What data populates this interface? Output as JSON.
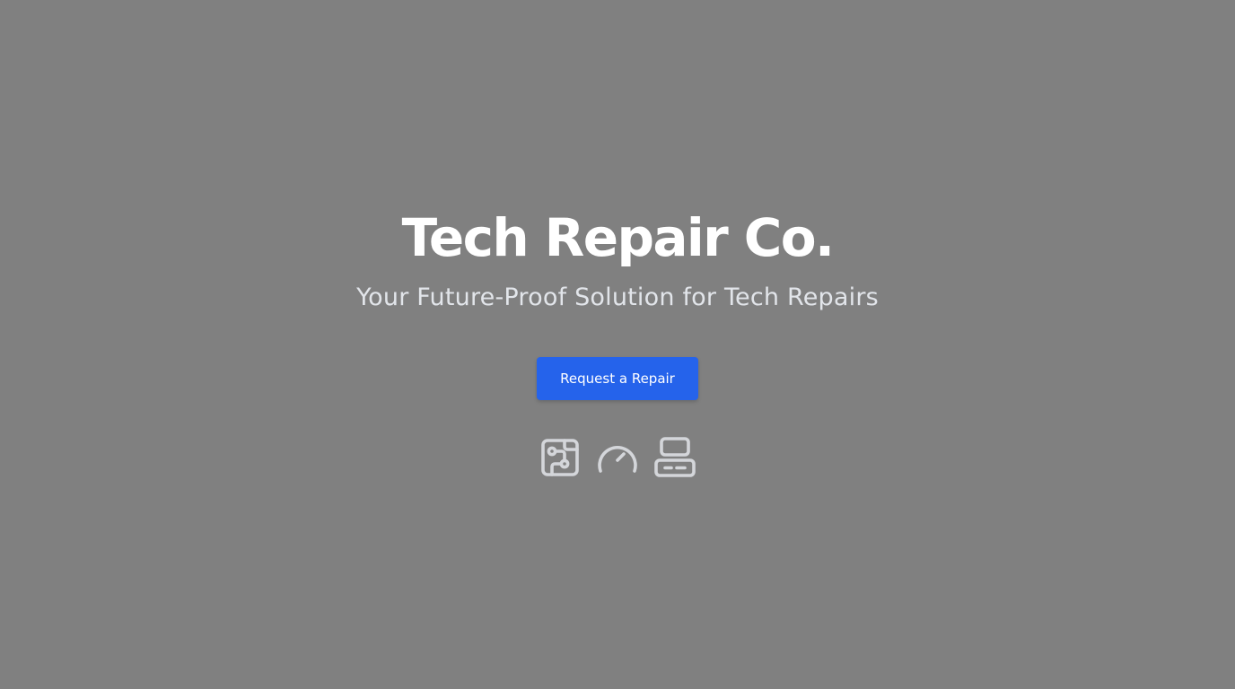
{
  "hero": {
    "title": "Tech Repair Co.",
    "subtitle": "Your Future-Proof Solution for Tech Repairs",
    "cta_label": "Request a Repair"
  },
  "features": {
    "icons": [
      "circuit-board-icon",
      "speedometer-icon",
      "device-stack-icon"
    ]
  },
  "colors": {
    "background": "#808080",
    "title": "#ffffff",
    "subtitle": "#e2e5ea",
    "accent": "#2563eb",
    "icon": "#d4d6da"
  }
}
